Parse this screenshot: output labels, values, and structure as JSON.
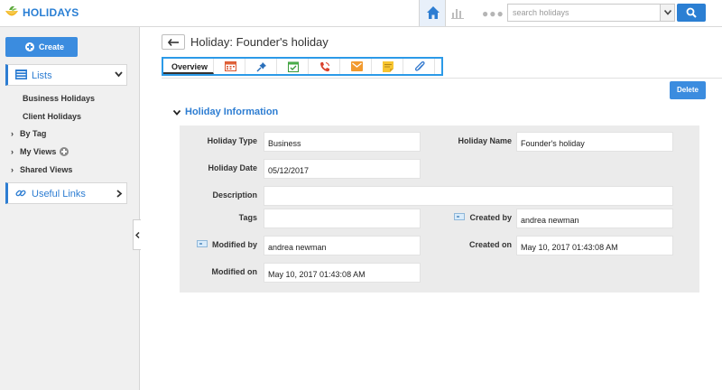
{
  "app": {
    "title": "HOLIDAYS"
  },
  "search": {
    "placeholder": "search holidays"
  },
  "sidebar": {
    "create_label": "Create",
    "lists_label": "Lists",
    "list_items": [
      "Business Holidays",
      "Client Holidays"
    ],
    "tree_items": [
      "By Tag",
      "My Views",
      "Shared Views"
    ],
    "useful_links_label": "Useful Links"
  },
  "page": {
    "title": "Holiday: Founder's holiday"
  },
  "tabs": {
    "overview_label": "Overview",
    "icons": [
      "calendar-icon",
      "pin-icon",
      "task-icon",
      "phone-icon",
      "email-icon",
      "note-icon",
      "attachment-icon"
    ]
  },
  "actions": {
    "delete_label": "Delete"
  },
  "section": {
    "title": "Holiday Information"
  },
  "fields": {
    "holiday_type": {
      "label": "Holiday Type",
      "value": "Business"
    },
    "holiday_name": {
      "label": "Holiday Name",
      "value": "Founder's holiday"
    },
    "holiday_date": {
      "label": "Holiday Date",
      "value": "05/12/2017"
    },
    "description": {
      "label": "Description",
      "value": ""
    },
    "tags": {
      "label": "Tags",
      "value": ""
    },
    "created_by": {
      "label": "Created by",
      "value": "andrea newman"
    },
    "modified_by": {
      "label": "Modified by",
      "value": "andrea newman"
    },
    "created_on": {
      "label": "Created on",
      "value": "May 10, 2017 01:43:08 AM"
    },
    "modified_on": {
      "label": "Modified on",
      "value": "May 10, 2017 01:43:08 AM"
    }
  },
  "colors": {
    "accent": "#2d7dd2",
    "button": "#3b8cdf",
    "tab_border": "#2b9ae8",
    "panel_bg": "#ebebeb",
    "sidebar_bg": "#f0f0f0"
  }
}
